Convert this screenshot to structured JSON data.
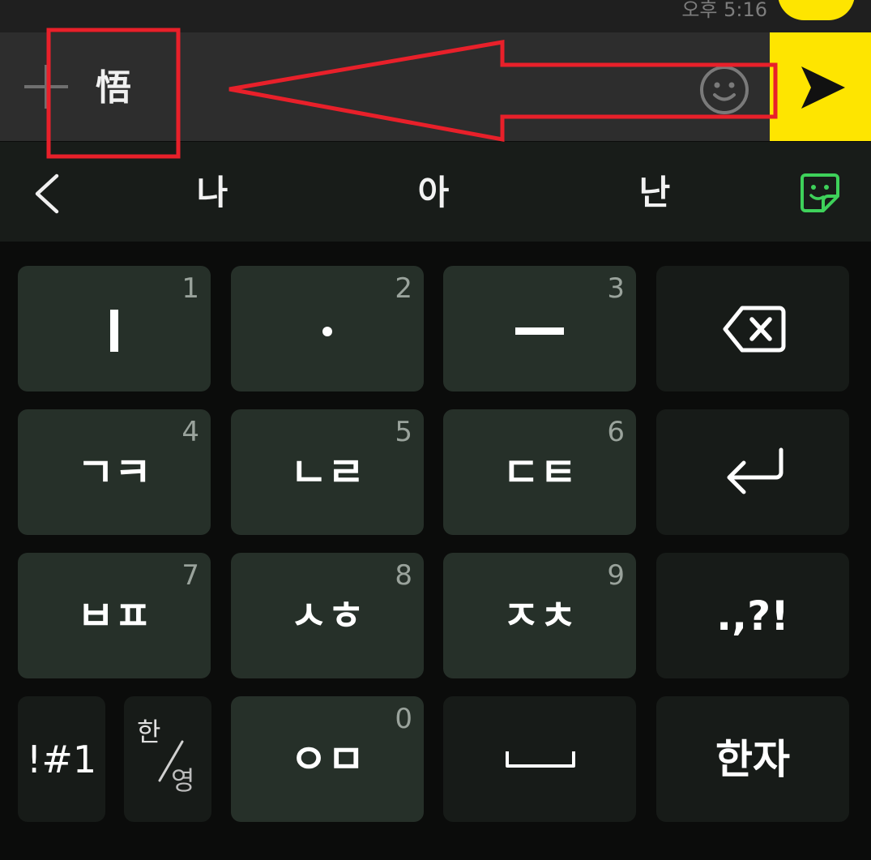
{
  "status": {
    "time": "오후 5:16"
  },
  "input": {
    "text": "悟"
  },
  "suggestions": [
    "나",
    "아",
    "난"
  ],
  "keys": {
    "k1": {
      "number": "1"
    },
    "k2": {
      "number": "2"
    },
    "k3": {
      "number": "3"
    },
    "k4": {
      "label": "ㄱㅋ",
      "number": "4"
    },
    "k5": {
      "label": "ㄴㄹ",
      "number": "5"
    },
    "k6": {
      "label": "ㄷㅌ",
      "number": "6"
    },
    "k7": {
      "label": "ㅂㅍ",
      "number": "7"
    },
    "k8": {
      "label": "ㅅㅎ",
      "number": "8"
    },
    "k9": {
      "label": "ㅈㅊ",
      "number": "9"
    },
    "punct": {
      "label": ".,?!"
    },
    "symbols": {
      "label": "!#1"
    },
    "lang_top": "한",
    "lang_bottom": "영",
    "k0": {
      "label": "ㅇㅁ",
      "number": "0"
    },
    "hanja": {
      "label": "한자"
    }
  },
  "colors": {
    "accent_yellow": "#fee500",
    "annotation_red": "#e8202a",
    "sticker_green": "#3ed15a"
  }
}
